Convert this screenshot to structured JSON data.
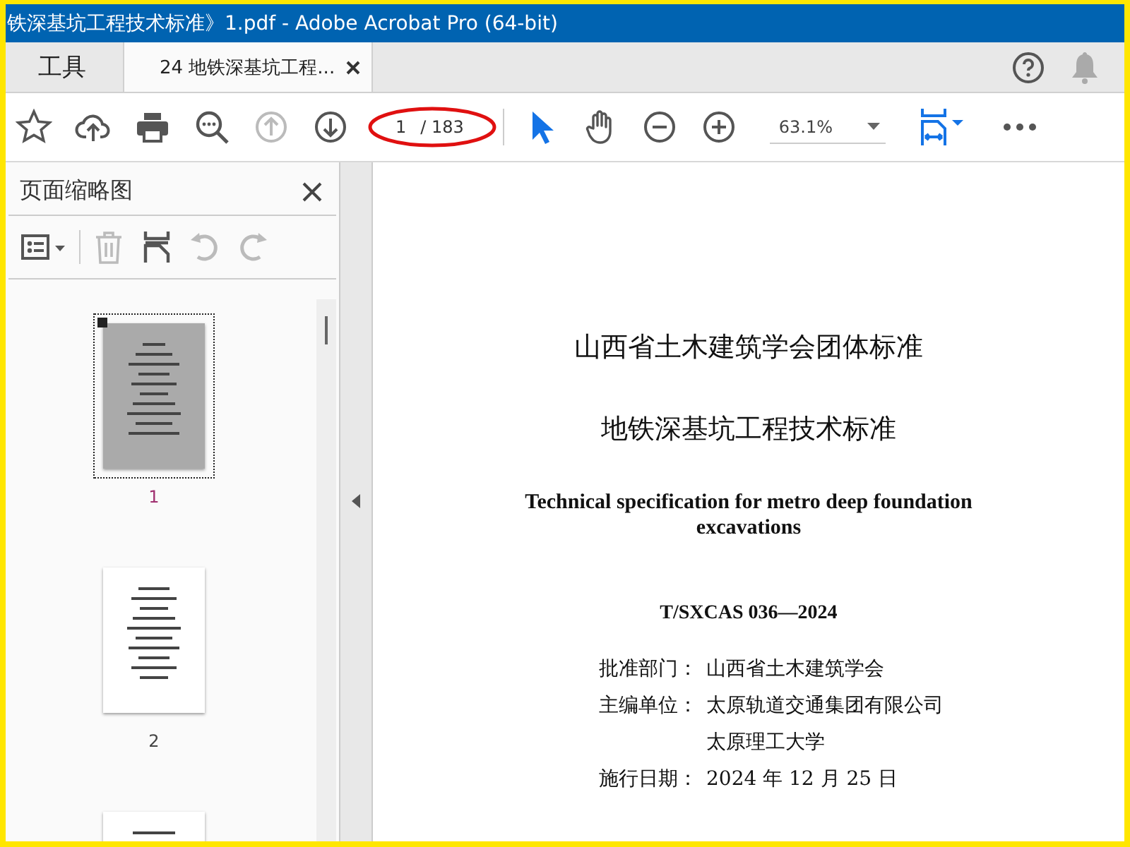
{
  "window": {
    "title": "铁深基坑工程技术标准》1.pdf - Adobe Acrobat Pro (64-bit)"
  },
  "tabs": [
    {
      "label": "工具",
      "selected": false,
      "closable": false
    },
    {
      "label": "24 地铁深基坑工程...",
      "selected": true,
      "closable": true
    }
  ],
  "header_icons": [
    {
      "kind": "help"
    },
    {
      "kind": "bell"
    }
  ],
  "toolbar": {
    "nav_buttons": [
      {
        "kind": "star",
        "disabled": false
      },
      {
        "kind": "upload",
        "disabled": false
      },
      {
        "kind": "print",
        "disabled": false
      },
      {
        "kind": "search",
        "disabled": false
      },
      {
        "kind": "up",
        "disabled": true
      },
      {
        "kind": "down",
        "disabled": false
      }
    ],
    "page_number": "1",
    "page_total": "/ 183",
    "page_highlighted": true,
    "mode_tools": [
      {
        "kind": "pointer",
        "selected": true
      },
      {
        "kind": "hand",
        "selected": false
      }
    ],
    "zoom_buttons": [
      {
        "kind": "zoom-out"
      },
      {
        "kind": "zoom-in"
      }
    ],
    "zoom": "63.1%"
  },
  "thumbnail_panel": {
    "title": "页面缩略图",
    "tools": [
      {
        "kind": "options",
        "disabled": false
      },
      {
        "kind": "delete",
        "disabled": true
      },
      {
        "kind": "insert",
        "disabled": false
      },
      {
        "kind": "rotate-left",
        "disabled": true
      },
      {
        "kind": "rotate-right",
        "disabled": true
      }
    ],
    "pages": [
      {
        "number": "1",
        "selected": true
      },
      {
        "number": "2",
        "selected": false
      },
      {
        "selected": false
      }
    ]
  },
  "document": {
    "heading": "山西省土木建筑学会团体标准",
    "title": "地铁深基坑工程技术标准",
    "english_title": "Technical specification for metro deep foundation excavations",
    "code": "T/SXCAS 036—2024",
    "fields": [
      {
        "label": "批准部门：",
        "values": [
          "山西省土木建筑学会"
        ]
      },
      {
        "label": "主编单位：",
        "values": [
          "太原轨道交通集团有限公司",
          "太原理工大学"
        ]
      },
      {
        "label": "施行日期：",
        "values": [
          "2024 年 12 月 25 日"
        ]
      }
    ]
  }
}
